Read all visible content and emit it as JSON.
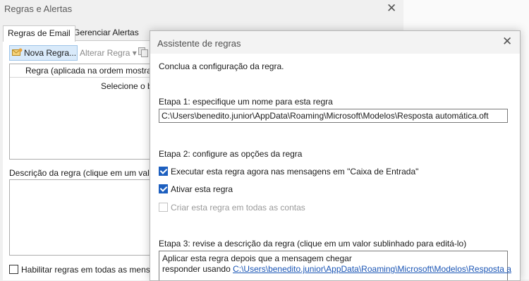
{
  "background_dialog": {
    "title": "Regras e Alertas",
    "tabs": [
      {
        "label": "Regras de Email"
      },
      {
        "label": "Gerenciar Alertas"
      }
    ],
    "toolbar": {
      "new_rule_label": "Nova Regra...",
      "change_rule_label": "Alterar Regra"
    },
    "rule_list": {
      "column_header": "Regra (aplicada na ordem mostrad",
      "empty_text": "Selecione o bo"
    },
    "description_label": "Descrição da regra (clique em um valor",
    "enable_all_label": "Habilitar regras em todas as mensag"
  },
  "wizard": {
    "title": "Assistente de regras",
    "intro": "Conclua a configuração da regra.",
    "step1_label": "Etapa 1: especifique um nome para esta regra",
    "rule_name": "C:\\Users\\benedito.junior\\AppData\\Roaming\\Microsoft\\Modelos\\Resposta automática.oft",
    "step2_label": "Etapa 2: configure as opções da regra",
    "options": {
      "run_now": {
        "label": "Executar esta regra agora nas mensagens em \"Caixa de Entrada\"",
        "checked": true
      },
      "enable": {
        "label": "Ativar esta regra",
        "checked": true
      },
      "all_accounts": {
        "label": "Criar esta regra em todas as contas",
        "checked": false,
        "disabled": true
      }
    },
    "step3_label": "Etapa 3: revise a descrição da regra (clique em um valor sublinhado para editá-lo)",
    "description": {
      "line1": "Aplicar esta regra depois que a mensagem chegar",
      "line2_prefix": "responder usando ",
      "line2_link": "C:\\Users\\benedito.junior\\AppData\\Roaming\\Microsoft\\Modelos\\Resposta a"
    }
  },
  "colors": {
    "highlight": "#f3e600",
    "checkbox_accent": "#1d5fbf",
    "link": "#1a55b5"
  }
}
